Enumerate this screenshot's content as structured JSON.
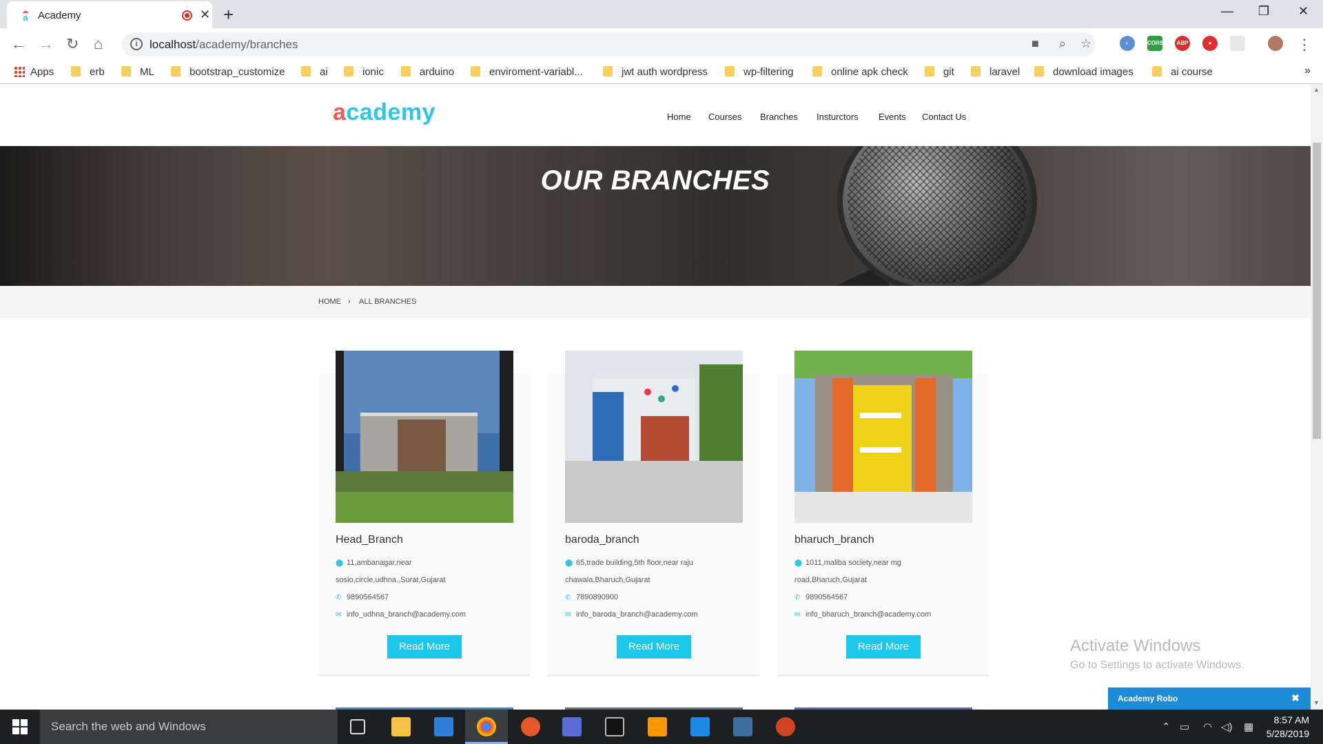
{
  "browser": {
    "tab_title": "Academy",
    "url_host": "localhost",
    "url_path": "/academy/branches",
    "bookmarks": [
      "Apps",
      "erb",
      "ML",
      "bootstrap_customize",
      "ai",
      "ionic",
      "arduino",
      "enviroment-variabl...",
      "jwt auth wordpress",
      "wp-filtering",
      "online apk check",
      "git",
      "laravel",
      "download images",
      "ai course"
    ]
  },
  "site": {
    "logo": "academy",
    "nav": [
      "Home",
      "Courses",
      "Branches",
      "Insturctors",
      "Events",
      "Contact Us"
    ],
    "hero_title": "OUR BRANCHES",
    "breadcrumb": [
      "HOME",
      "ALL BRANCHES"
    ]
  },
  "branches": [
    {
      "name": "Head_Branch",
      "address_1": "11,ambanagar,near",
      "address_2": "sosio,circle,udhna.,Surat,Gujarat",
      "phone": "9890564567",
      "email": "info_udhna_branch@academy.com",
      "button": "Read More"
    },
    {
      "name": "baroda_branch",
      "address_1": "65,trade building,5th floor,near raju",
      "address_2": "chawala,Bharuch,Gujarat",
      "phone": "7890890900",
      "email": "info_baroda_branch@academy.com",
      "button": "Read More"
    },
    {
      "name": "bharuch_branch",
      "address_1": "1011,maliba society,near mg",
      "address_2": "road,Bharuch,Gujarat",
      "phone": "9890564567",
      "email": "info_bharuch_branch@academy.com",
      "button": "Read More"
    }
  ],
  "windows": {
    "activate_title": "Activate Windows",
    "activate_sub": "Go to Settings to activate Windows.",
    "search_placeholder": "Search the web and Windows",
    "time": "8:57 AM",
    "date": "5/28/2019"
  },
  "chat": {
    "title": "Academy Robo",
    "close": "✖"
  },
  "colors": {
    "accent": "#1cc8ea",
    "logo_red": "#f05a5a"
  }
}
